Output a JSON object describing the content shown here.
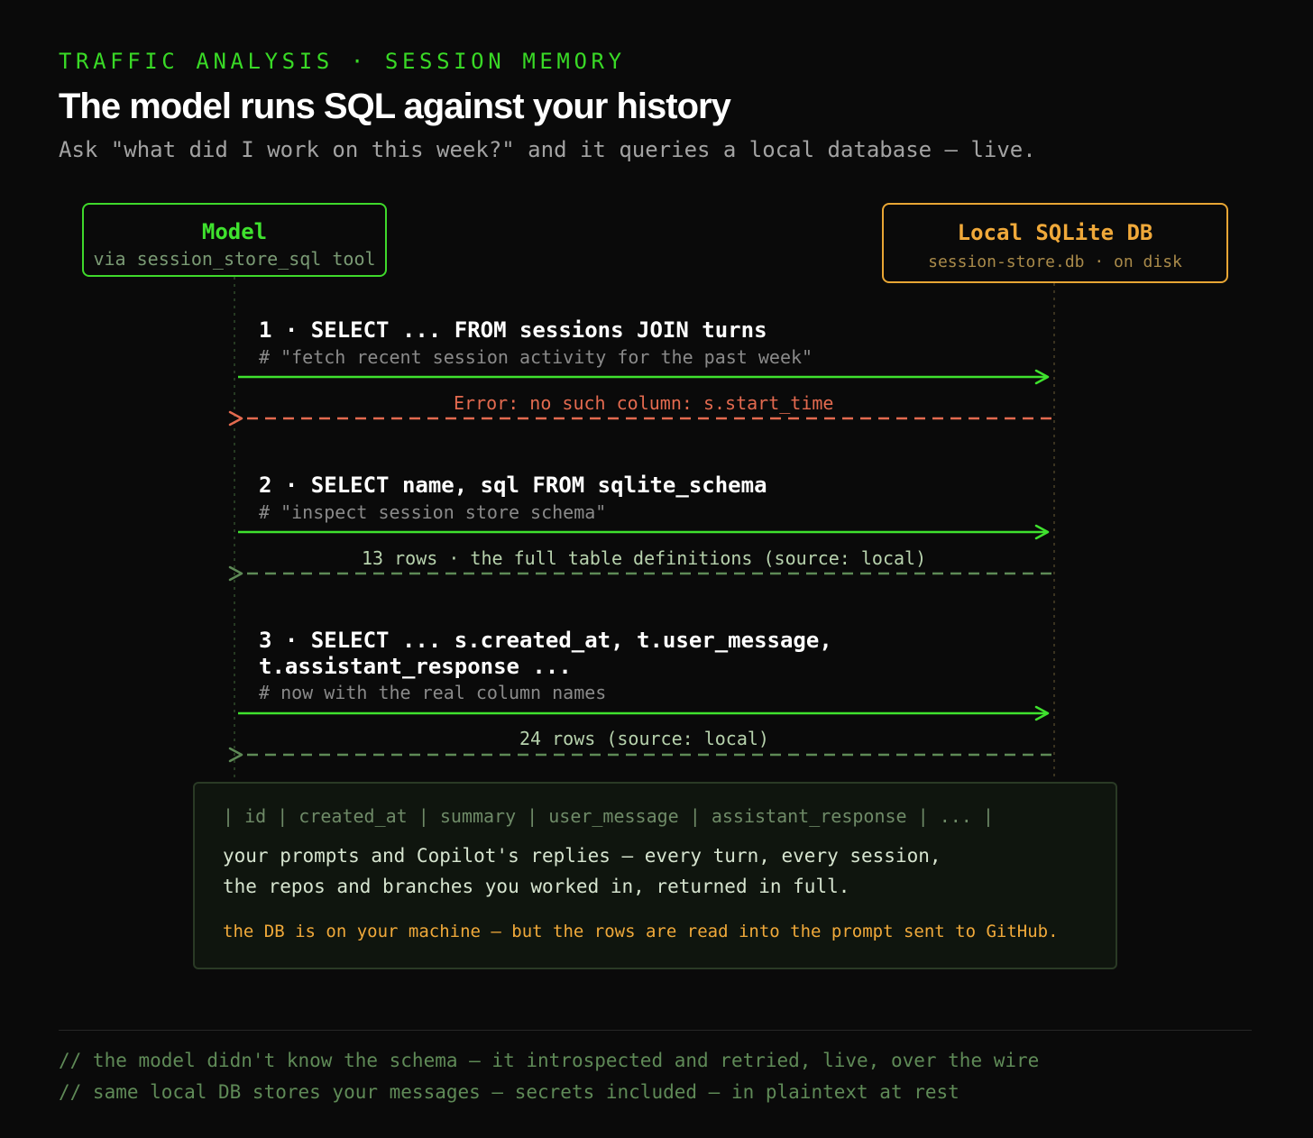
{
  "header": {
    "eyebrow": "TRAFFIC ANALYSIS · SESSION MEMORY",
    "title": "The model runs SQL against your history",
    "subtitle": "Ask \"what did I work on this week?\" and it queries a local database — live."
  },
  "actors": {
    "model": {
      "name": "Model",
      "sub": "via session_store_sql tool"
    },
    "db": {
      "name": "Local SQLite DB",
      "sub": "session-store.db · on disk"
    }
  },
  "messages": [
    {
      "sql": "1 · SELECT ... FROM sessions JOIN turns",
      "note": "# \"fetch recent session activity for the past week\"",
      "reply": "Error: no such column: s.start_time",
      "reply_status": "error"
    },
    {
      "sql": "2 · SELECT name, sql FROM sqlite_schema",
      "note": "# \"inspect session store schema\"",
      "reply": "13 rows · the full table definitions (source: local)",
      "reply_status": "ok"
    },
    {
      "sql_line1": "3 · SELECT ... s.created_at, t.user_message,",
      "sql_line2": "t.assistant_response ...",
      "note": "# now with the real column names",
      "reply": "24 rows (source: local)",
      "reply_status": "ok"
    }
  ],
  "result": {
    "header": "| id | created_at | summary | user_message | assistant_response | ... |",
    "line1": "your prompts and Copilot's replies — every turn, every session,",
    "line2": "the repos and branches you worked in, returned in full.",
    "warning": "the DB is on your machine — but the rows are read into the prompt sent to GitHub."
  },
  "footer": {
    "line1": "// the model didn't know the schema — it introspected and retried, live, over the wire",
    "line2": "// same local DB stores your messages — secrets included — in plaintext at rest"
  },
  "colors": {
    "background": "#0a0a0a",
    "accent_green": "#3fe22e",
    "accent_amber": "#f0a93a",
    "error_red": "#e36a4f",
    "reply_green": "#5e8a56"
  }
}
